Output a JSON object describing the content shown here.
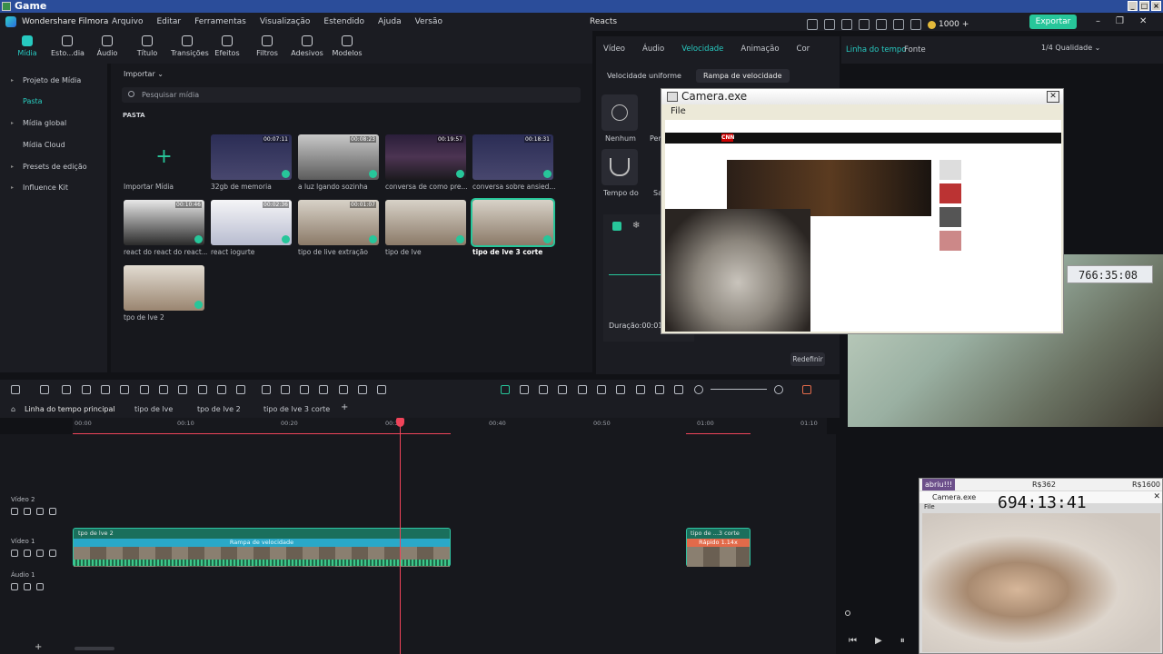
{
  "window_title": "Game",
  "menubar": {
    "brand": "Wondershare Filmora",
    "menu": [
      "Arquivo",
      "Editar",
      "Ferramentas",
      "Visualização",
      "Estendido",
      "Ajuda",
      "Versão"
    ],
    "project_name": "Reacts",
    "coins": "1000",
    "export_label": "Exportar"
  },
  "media_tabs": [
    "Mídia",
    "Esto...dia",
    "Áudio",
    "Título",
    "Transições",
    "Efeitos",
    "Filtros",
    "Adesivos",
    "Modelos"
  ],
  "sidebar": [
    {
      "label": "Projeto de Mídia",
      "active": false,
      "caret": true
    },
    {
      "label": "Pasta",
      "active": true,
      "caret": false
    },
    {
      "label": "Mídia global",
      "active": false,
      "caret": true
    },
    {
      "label": "Mídia Cloud",
      "active": false,
      "caret": false
    },
    {
      "label": "Presets de edição",
      "active": false,
      "caret": true
    },
    {
      "label": "Influence Kit",
      "active": false,
      "caret": true
    }
  ],
  "media": {
    "import_label": "Importar",
    "search_placeholder": "Pesquisar mídia",
    "folder_label": "PASTA",
    "import_tile_label": "Importar Mídia",
    "items": [
      {
        "label": "32gb de memoria",
        "duration": "00:07:11"
      },
      {
        "label": "a luz lgando sozinha",
        "duration": "00:08:23"
      },
      {
        "label": "conversa de como pre...",
        "duration": "00:19:57"
      },
      {
        "label": "conversa sobre ansied...",
        "duration": "00:18:31"
      },
      {
        "label": "react do react do react...",
        "duration": "00:10:46"
      },
      {
        "label": "react iogurte",
        "duration": "00:02:36"
      },
      {
        "label": "tipo de live extração",
        "duration": "00:01:07"
      },
      {
        "label": "tipo de lve",
        "duration": ""
      },
      {
        "label": "tipo de lve 3 corte",
        "duration": ""
      },
      {
        "label": "tpo de lve 2",
        "duration": ""
      }
    ]
  },
  "props": {
    "tabs": [
      "Vídeo",
      "Áudio",
      "Velocidade",
      "Animação",
      "Cor"
    ],
    "active_tab": "Velocidade",
    "subtabs": [
      "Velocidade uniforme",
      "Rampa de velocidade"
    ],
    "presets": [
      "Nenhum",
      "Per",
      "Tempo do",
      "Sa"
    ],
    "duration_label": "Duração:00:01:0",
    "reset_label": "Redefinir"
  },
  "preview_tabs": {
    "a": "Linha do tempo",
    "b": "Fonte",
    "quality": "1/4 Qualidade"
  },
  "camera1": {
    "title": "Camera.exe",
    "menu": "File",
    "cnn": "CNN"
  },
  "timer1": "766:35:08",
  "timeline": {
    "tabs": [
      "Linha do tempo principal",
      "tipo de lve",
      "tpo de lve 2",
      "tipo de lve 3 corte"
    ],
    "ruler": [
      "00:00",
      "00:10",
      "00:20",
      "00:30",
      "00:40",
      "00:50",
      "01:00",
      "01:10"
    ],
    "tracks": [
      "Vídeo 2",
      "Vídeo 1",
      "Áudio 1"
    ],
    "clip1": {
      "name": "tpo de lve 2",
      "speed": "Rampa de velocidade"
    },
    "clip2": {
      "name": "tipo de ...3 corte",
      "speed": "Rápido 1.14x"
    }
  },
  "camera2": {
    "user": "abriu!!!",
    "amount1": "R$362",
    "amount2": "R$1600",
    "title": "Camera.exe",
    "timer": "694:13:41",
    "file": "File"
  }
}
